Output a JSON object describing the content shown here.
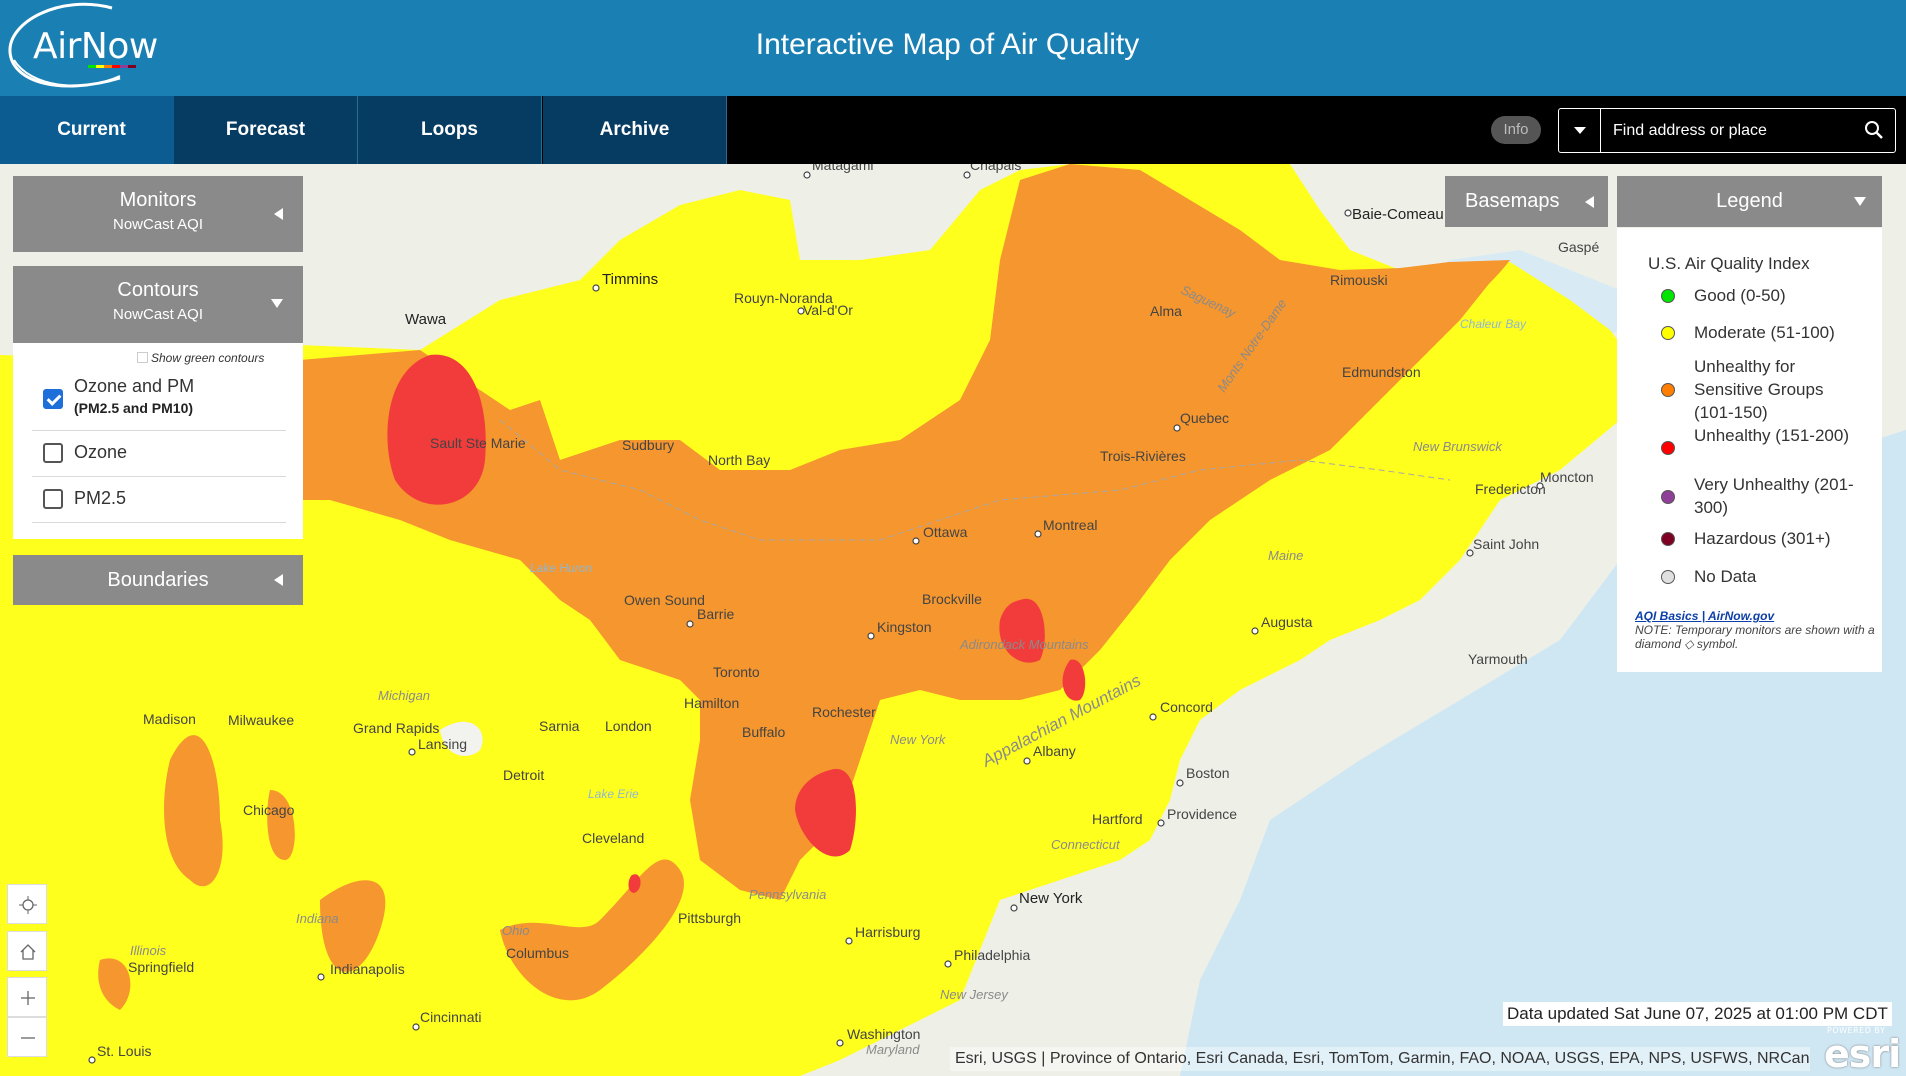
{
  "header": {
    "logo_text": "AirNow",
    "title": "Interactive Map of Air Quality"
  },
  "nav": {
    "tabs": [
      {
        "label": "Current",
        "active": true
      },
      {
        "label": "Forecast",
        "active": false
      },
      {
        "label": "Loops",
        "active": false
      },
      {
        "label": "Archive",
        "active": false
      }
    ],
    "info_label": "Info",
    "search_placeholder": "Find address or place"
  },
  "panels": {
    "monitors": {
      "title": "Monitors",
      "subtitle": "NowCast AQI"
    },
    "contours": {
      "title": "Contours",
      "subtitle": "NowCast AQI",
      "show_green_label": "Show green contours",
      "options": [
        {
          "label": "Ozone and PM",
          "sublabel": "(PM2.5 and PM10)",
          "checked": true
        },
        {
          "label": "Ozone",
          "sublabel": "",
          "checked": false
        },
        {
          "label": "PM2.5",
          "sublabel": "",
          "checked": false
        }
      ]
    },
    "boundaries": {
      "title": "Boundaries"
    },
    "basemaps": {
      "title": "Basemaps"
    }
  },
  "legend": {
    "title": "Legend",
    "index_title": "U.S. Air Quality Index",
    "items": [
      {
        "label": "Good (0-50)",
        "color": "#00e400"
      },
      {
        "label": "Moderate (51-100)",
        "color": "#ffff00"
      },
      {
        "label": "Unhealthy for Sensitive Groups (101-150)",
        "color": "#ff7e00"
      },
      {
        "label": "Unhealthy (151-200)",
        "color": "#ff0000"
      },
      {
        "label": "Very Unhealthy (201-300)",
        "color": "#8f3f97"
      },
      {
        "label": "Hazardous (301+)",
        "color": "#7e0023"
      },
      {
        "label": "No Data",
        "color": "#e0e0e0"
      }
    ],
    "link": "AQI Basics | AirNow.gov",
    "note": "NOTE: Temporary monitors are shown with a diamond ◇ symbol."
  },
  "map": {
    "aqi_colors": {
      "moderate": "#ffff1e",
      "usg": "#f5962e",
      "unhealthy": "#f23c3c",
      "land": "#eef0e8",
      "water": "#cfe6f3"
    },
    "cities": [
      "Matagami",
      "Chapais",
      "Baie-Comeau",
      "Gaspé",
      "Timmins",
      "Rouyn-Noranda",
      "Val-d'Or",
      "Alma",
      "Rimouski",
      "Wawa",
      "Edmundston",
      "Sault Ste Marie",
      "Sudbury",
      "North Bay",
      "Quebec",
      "Trois-Rivières",
      "Fredericton",
      "Moncton",
      "Ottawa",
      "Montreal",
      "Saint John",
      "Owen Sound",
      "Barrie",
      "Brockville",
      "Kingston",
      "Augusta",
      "Yarmouth",
      "Toronto",
      "Madison",
      "Milwaukee",
      "Michigan",
      "Grand Rapids",
      "Lansing",
      "Hamilton",
      "Sarnia",
      "London",
      "Buffalo",
      "Rochester",
      "Concord",
      "Albany",
      "Detroit",
      "Boston",
      "Chicago",
      "Cleveland",
      "Hartford",
      "Providence",
      "Indiana",
      "Pittsburgh",
      "New York",
      "Springfield",
      "Illinois",
      "Indianapolis",
      "Ohio",
      "Columbus",
      "Harrisburg",
      "Philadelphia",
      "Pennsylvania",
      "New Jersey",
      "Cincinnati",
      "Washington",
      "Maryland",
      "St. Louis",
      "Connecticut"
    ],
    "regions": [
      "New York",
      "Maine",
      "New Brunswick",
      "Lake Huron",
      "Lake Erie",
      "Adirondack Mountains",
      "Appalachian Mountains",
      "Saguenay",
      "Monts Notre-Dame",
      "Chaleur Bay"
    ]
  },
  "status": {
    "data_updated": "Data updated Sat June 07, 2025 at 01:00 PM CDT",
    "attribution": "Esri, USGS | Province of Ontario, Esri Canada, Esri, TomTom, Garmin, FAO, NOAA, USGS, EPA, NPS, USFWS, NRCan, ...",
    "esri_powered": "POWERED BY",
    "esri_word": "esri"
  }
}
